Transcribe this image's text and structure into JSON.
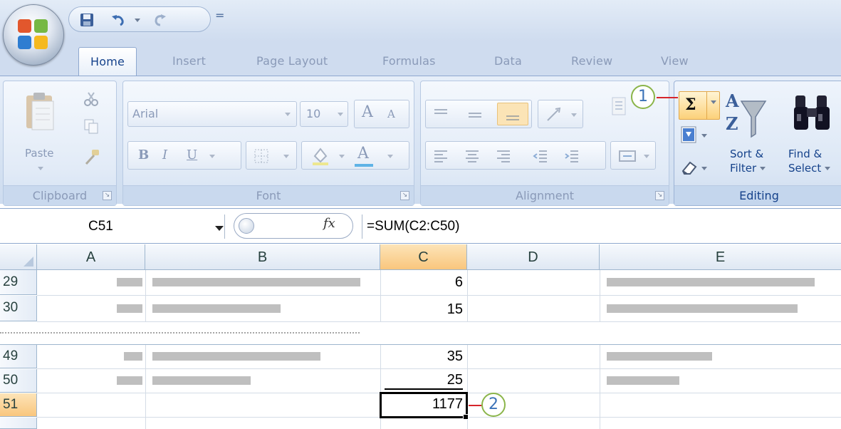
{
  "quick_access": {
    "customize_glyph": "="
  },
  "tabs": [
    {
      "label": "Home",
      "active": true
    },
    {
      "label": "Insert",
      "active": false
    },
    {
      "label": "Page Layout",
      "active": false
    },
    {
      "label": "Formulas",
      "active": false
    },
    {
      "label": "Data",
      "active": false
    },
    {
      "label": "Review",
      "active": false
    },
    {
      "label": "View",
      "active": false
    }
  ],
  "ribbon": {
    "clipboard": {
      "label": "Clipboard",
      "paste_label": "Paste"
    },
    "font": {
      "label": "Font",
      "font_name": "Arial",
      "font_size": "10",
      "grow": "A",
      "shrink": "A",
      "bold": "B",
      "italic": "I",
      "underline": "U",
      "color_letter": "A"
    },
    "alignment": {
      "label": "Alignment"
    },
    "editing": {
      "label": "Editing",
      "autosum_symbol": "Σ",
      "sort_label_1": "Sort &",
      "sort_label_2": "Filter",
      "find_label_1": "Find &",
      "find_label_2": "Select"
    }
  },
  "formula_bar": {
    "name_box": "C51",
    "fx_label": "fx",
    "formula": "=SUM(C2:C50)"
  },
  "sheet": {
    "columns": [
      "A",
      "B",
      "C",
      "D",
      "E"
    ],
    "selected_column": "C",
    "rows": [
      {
        "number": "29",
        "c": "6"
      },
      {
        "number": "30",
        "c": "15"
      },
      {
        "number": "49",
        "c": "35"
      },
      {
        "number": "50",
        "c": "25"
      },
      {
        "number": "51",
        "c": "1177",
        "selected": true
      }
    ]
  },
  "callouts": [
    "1",
    "2"
  ],
  "colors": {
    "callout_border": "#8bb54a",
    "callout_text": "#3c73b8",
    "callout_line": "#d6252b",
    "selected_header": "#f9c67d"
  }
}
